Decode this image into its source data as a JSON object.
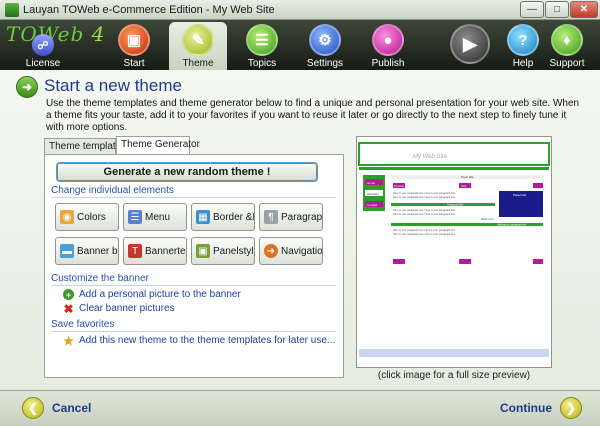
{
  "window": {
    "title": "Lauyan TOWeb e-Commerce Edition - My Web Site",
    "min_icon": "minimize-icon",
    "max_icon": "maximize-icon",
    "close_icon": "close-icon"
  },
  "toolbar": {
    "logo": "TOWeb",
    "logo_version": "4",
    "items": [
      {
        "label": "License",
        "icon": "shield-icon"
      },
      {
        "label": "Start",
        "icon": "start-icon"
      },
      {
        "label": "Theme",
        "icon": "paintbrush-icon"
      },
      {
        "label": "Topics",
        "icon": "topics-icon"
      },
      {
        "label": "Settings",
        "icon": "settings-icon"
      },
      {
        "label": "Publish",
        "icon": "publish-icon"
      },
      {
        "label": "Help",
        "icon": "help-icon"
      },
      {
        "label": "Support",
        "icon": "support-icon"
      }
    ],
    "play_icon": "play-icon"
  },
  "main": {
    "title": "Start a new theme",
    "intro": "Use the theme templates and theme generator below to find a unique and personal presentation for your web site. When a theme fits your taste, add it to your favorites if you want to reuse it later or go directly to the next step to finely tune it with more options.",
    "tabs": [
      {
        "label": "Theme templates"
      },
      {
        "label": "Theme Generator"
      }
    ],
    "generate_label": "Generate a new random theme !",
    "section_change": "Change individual elements",
    "elements": [
      {
        "label": "Colors"
      },
      {
        "label": "Menu"
      },
      {
        "label": "Border &Layout"
      },
      {
        "label": "Paragraphstyle"
      },
      {
        "label": "Banner background"
      },
      {
        "label": "Bannertext"
      },
      {
        "label": "Panelstyle"
      },
      {
        "label": "Navigationbar"
      }
    ],
    "section_banner": "Customize the banner",
    "add_picture": "Add a personal picture to the banner",
    "clear_pictures": "Clear banner pictures",
    "section_favorites": "Save favorites",
    "add_favorite": "Add this new theme to the theme templates for later use...",
    "preview_caption": "(click image for a full size preview)",
    "preview": {
      "site_title": "My Web Site",
      "menu": [
        "Home",
        "Services",
        "Contact"
      ],
      "topic_title": "Topic title",
      "prev": "Previous",
      "next": "Next",
      "panel": "Panel title",
      "text_line": "Here is your paragraph text. Here is your paragraph text.",
      "para_title": "Paragraph title",
      "highlight_title": "Highlighted paragraph title",
      "read_more": "Read more..."
    }
  },
  "footer": {
    "cancel": "Cancel",
    "continue": "Continue"
  }
}
